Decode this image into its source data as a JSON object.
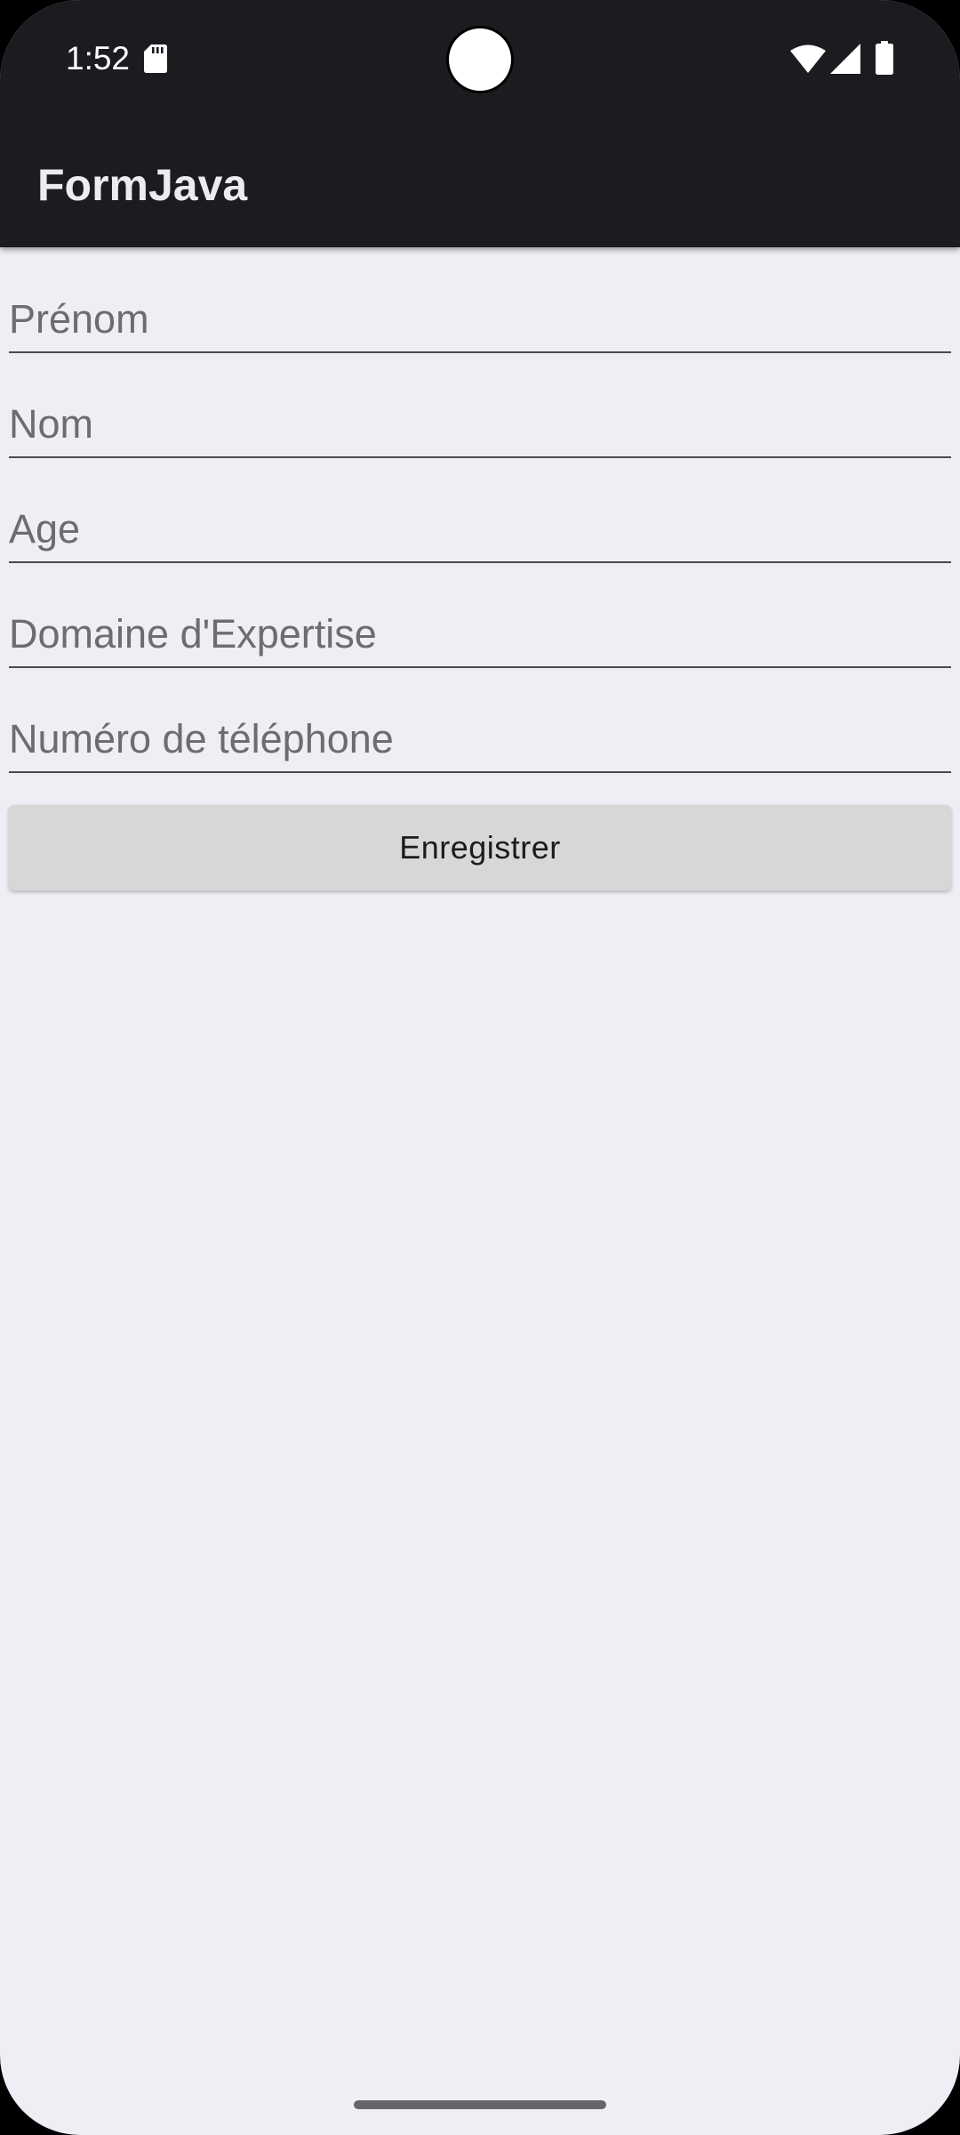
{
  "status_bar": {
    "time": "1:52",
    "icons": [
      "sd-card-icon",
      "wifi-icon",
      "signal-icon",
      "battery-icon"
    ]
  },
  "app_bar": {
    "title": "FormJava"
  },
  "form": {
    "fields": [
      {
        "placeholder": "Prénom",
        "value": ""
      },
      {
        "placeholder": "Nom",
        "value": ""
      },
      {
        "placeholder": "Age",
        "value": ""
      },
      {
        "placeholder": "Domaine d'Expertise",
        "value": ""
      },
      {
        "placeholder": "Numéro de téléphone",
        "value": ""
      }
    ],
    "save_label": "Enregistrer"
  },
  "colors": {
    "app_bar_bg": "#1b1b20",
    "screen_bg": "#efeef4",
    "button_bg": "#d6d7d7",
    "hint_text": "#6d6c72",
    "underline": "#4a494f"
  }
}
